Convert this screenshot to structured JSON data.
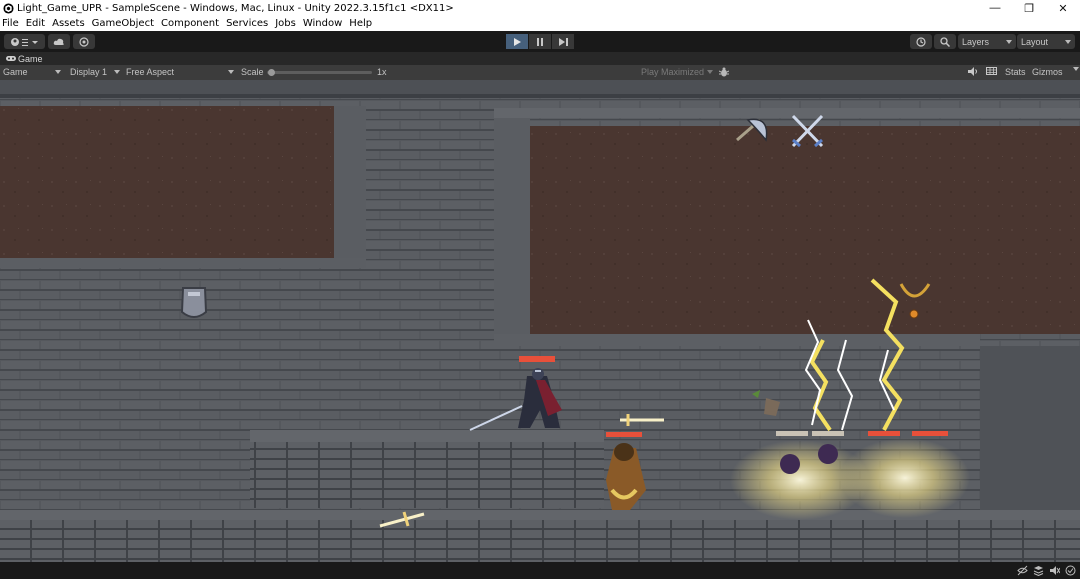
{
  "window": {
    "title": "Light_Game_UPR - SampleScene - Windows, Mac, Linux - Unity 2022.3.15f1c1 <DX11>",
    "minimize_glyph": "—",
    "maximize_glyph": "❐",
    "close_glyph": "✕"
  },
  "menu": [
    "File",
    "Edit",
    "Assets",
    "GameObject",
    "Component",
    "Services",
    "Jobs",
    "Window",
    "Help"
  ],
  "toolbar": {
    "account_icon": "account-icon",
    "cloud_icon": "cloud-icon",
    "collab_icon": "collab-icon",
    "play_icon": "play-icon",
    "pause_icon": "pause-icon",
    "step_icon": "step-icon",
    "history_icon": "history-icon",
    "search_icon": "search-icon",
    "layers_label": "Layers",
    "layout_label": "Layout"
  },
  "game_tab": {
    "label": "Game"
  },
  "game_options": {
    "view_select": "Game",
    "display_select": "Display 1",
    "aspect_select": "Free Aspect",
    "scale_label": "Scale",
    "scale_value": "1x",
    "play_mode": "Play Maximized",
    "stats_label": "Stats",
    "gizmos_label": "Gizmos"
  },
  "colors": {
    "play_active": "#46607c",
    "brick": "#5a5d62",
    "mortar": "#3e4146",
    "dirt": "#4a3730",
    "lightning": "#f0e060",
    "health_bar": "#e8503a"
  }
}
